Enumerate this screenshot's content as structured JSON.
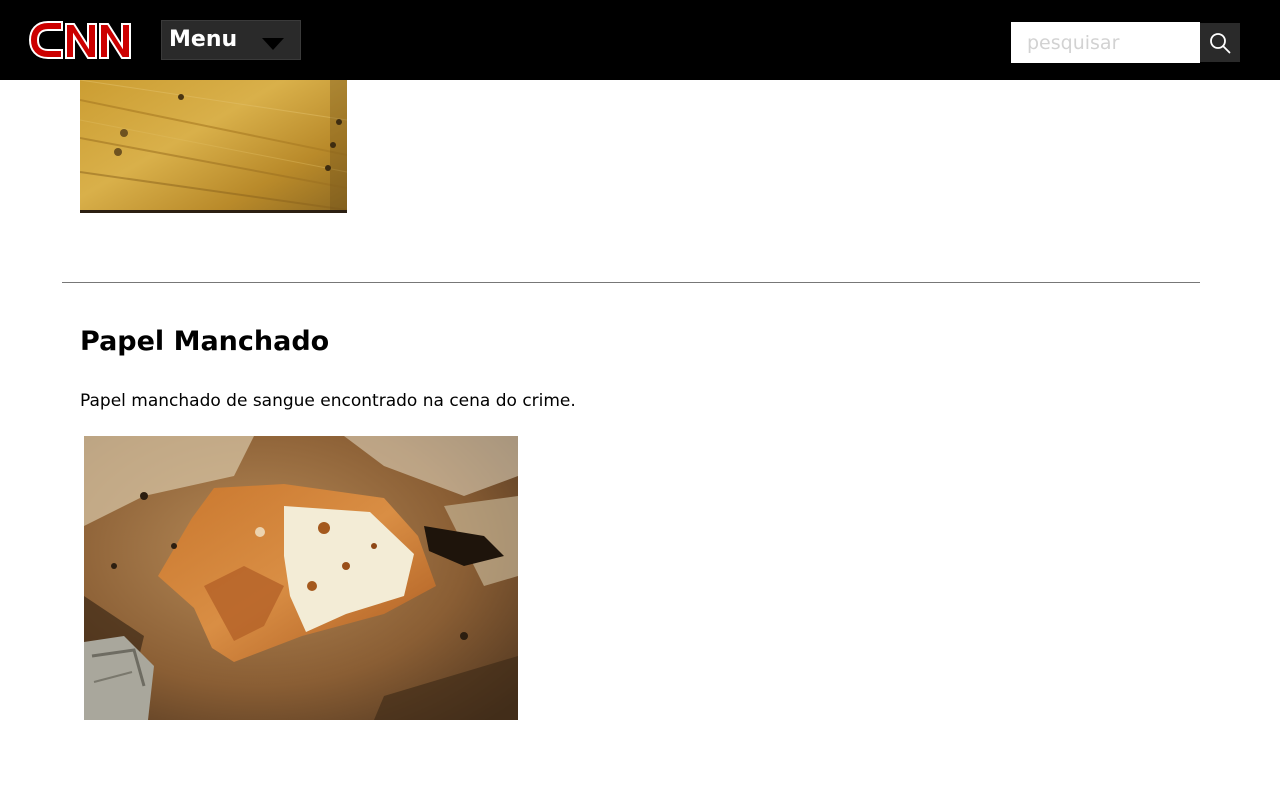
{
  "header": {
    "logo_text": "CNN",
    "menu_label": "Menu",
    "search": {
      "placeholder": "pesquisar"
    }
  },
  "evidence": {
    "title": "Papel Manchado",
    "description": "Papel manchado de sangue encontrado na cena do crime."
  },
  "colors": {
    "header_bg": "#000000",
    "brand_red": "#cc0000",
    "menu_bg": "#2a2a2a"
  }
}
